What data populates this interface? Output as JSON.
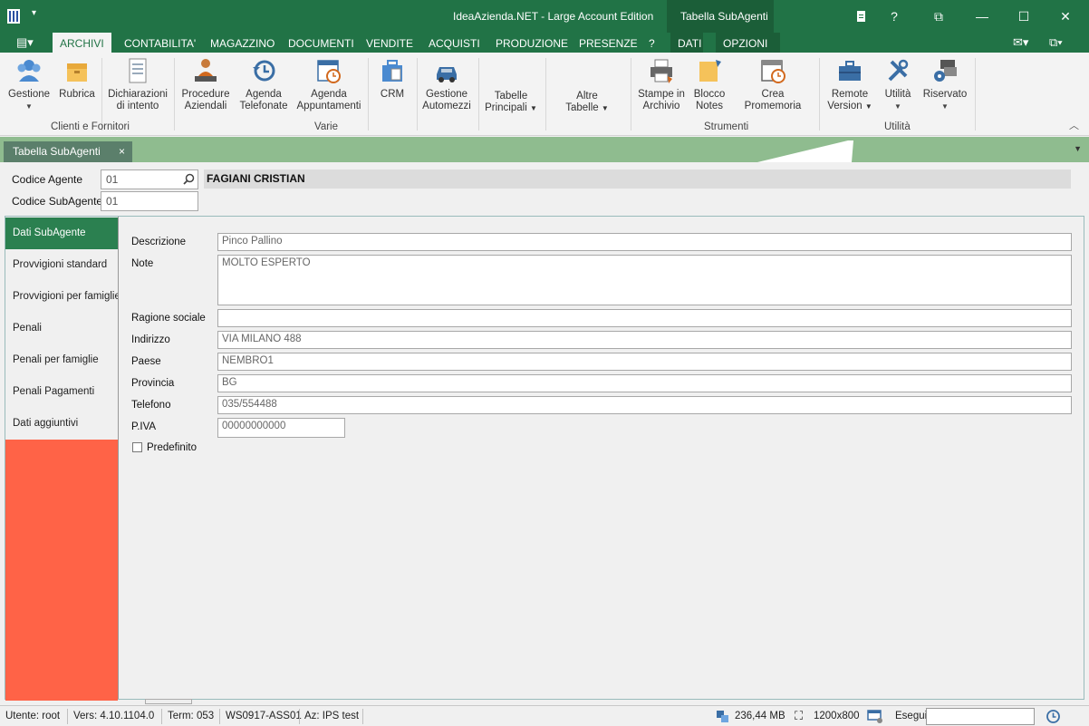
{
  "window": {
    "title": "IdeaAzienda.NET - Large Account Edition",
    "context_tab": "Tabella SubAgenti",
    "controls": [
      "?",
      "⧉",
      "—",
      "☐",
      "✕"
    ]
  },
  "menu": {
    "tabs": [
      "ARCHIVI",
      "CONTABILITA'",
      "MAGAZZINO",
      "DOCUMENTI",
      "VENDITE",
      "ACQUISTI",
      "PRODUZIONE",
      "PRESENZE",
      "?",
      "DATI",
      "OPZIONI"
    ],
    "active": "ARCHIVI"
  },
  "ribbon": {
    "buttons": [
      {
        "label": "Gestione",
        "dropdown": true,
        "icon": "users-icon"
      },
      {
        "label": "Rubrica",
        "dropdown": false,
        "icon": "box-icon"
      },
      {
        "label": "Dichiarazioni\ndi intento",
        "dropdown": false,
        "icon": "document-icon"
      },
      {
        "label": "Procedure\nAziendali",
        "dropdown": false,
        "icon": "person-desk-icon"
      },
      {
        "label": "Agenda\nTelefonate",
        "dropdown": false,
        "icon": "history-icon"
      },
      {
        "label": "Agenda\nAppuntamenti",
        "dropdown": false,
        "icon": "calendar-clock-icon"
      },
      {
        "label": "CRM",
        "dropdown": false,
        "icon": "briefcase-docs-icon"
      },
      {
        "label": "Gestione\nAutomezzi",
        "dropdown": false,
        "icon": "car-icon"
      },
      {
        "label": "Tabelle\nPrincipali",
        "dropdown": true,
        "icon": ""
      },
      {
        "label": "Altre\nTabelle",
        "dropdown": true,
        "icon": ""
      },
      {
        "label": "Stampe in\nArchivio",
        "dropdown": false,
        "icon": "printer-icon"
      },
      {
        "label": "Blocco\nNotes",
        "dropdown": false,
        "icon": "sticky-note-icon"
      },
      {
        "label": "Crea Promemoria",
        "dropdown": false,
        "icon": "calendar-alarm-icon"
      },
      {
        "label": "Remote\nVersion",
        "dropdown": true,
        "icon": "toolbox-icon"
      },
      {
        "label": "Utilità",
        "dropdown": true,
        "icon": "tools-icon"
      },
      {
        "label": "Riservato",
        "dropdown": true,
        "icon": "gear-windows-icon"
      }
    ],
    "groups": [
      "Clienti e Fornitori",
      "Varie",
      "Strumenti",
      "Utilità"
    ]
  },
  "doc_tab": {
    "label": "Tabella SubAgenti",
    "close": "×"
  },
  "header": {
    "codice_agente_label": "Codice Agente",
    "codice_agente_value": "01",
    "codice_subagente_label": "Codice SubAgente",
    "codice_subagente_value": "01",
    "agent_name": "FAGIANI CRISTIAN"
  },
  "sidebar": {
    "items": [
      "Dati SubAgente",
      "Provvigioni standard",
      "Provvigioni per famiglie",
      "Penali",
      "Penali per famiglie",
      "Penali Pagamenti",
      "Dati aggiuntivi"
    ],
    "active": "Dati SubAgente"
  },
  "form": {
    "descrizione_label": "Descrizione",
    "descrizione": "Pinco Pallino",
    "note_label": "Note",
    "note": "MOLTO ESPERTO",
    "ragione_label": "Ragione sociale",
    "ragione": "",
    "indirizzo_label": "Indirizzo",
    "indirizzo": "VIA MILANO 488",
    "paese_label": "Paese",
    "paese": "NEMBRO1",
    "provincia_label": "Provincia",
    "provincia": "BG",
    "telefono_label": "Telefono",
    "telefono": "035/554488",
    "piva_label": "P.IVA",
    "piva": "00000000000",
    "predefinito_label": "Predefinito",
    "predefinito": false
  },
  "status": {
    "utente": "Utente: root",
    "versione": "Vers: 4.10.1104.0",
    "term": "Term: 053",
    "ws": "WS0917-ASS01",
    "az": "Az: IPS test",
    "memory": "236,44 MB",
    "resolution": "1200x800",
    "esegui_label": "Esegui"
  },
  "colors": {
    "brand": "#217346",
    "sidebar_accent": "#ff6347",
    "active_item": "#2b8050"
  }
}
